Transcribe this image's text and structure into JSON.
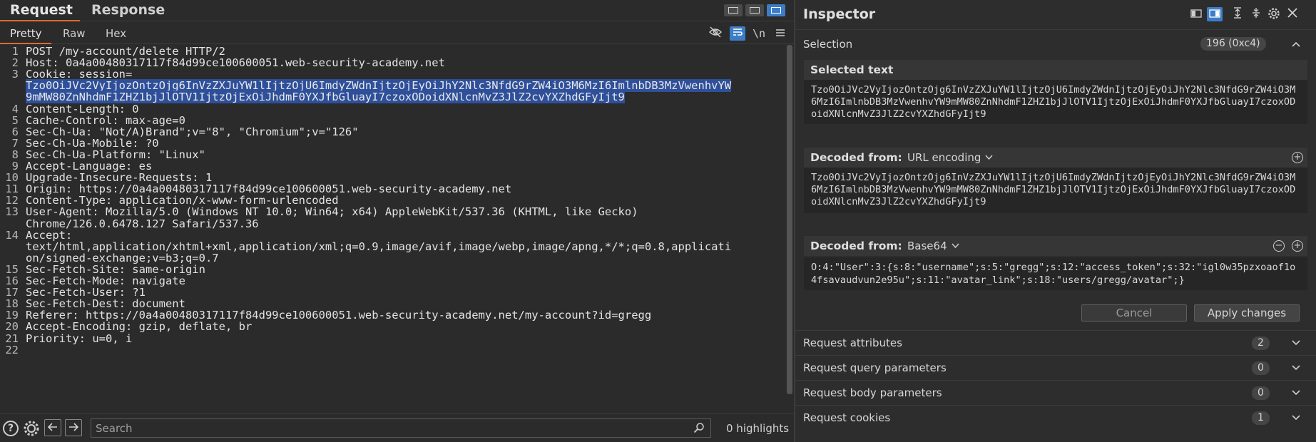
{
  "tabs": {
    "request": "Request",
    "response": "Response"
  },
  "view_tabs": {
    "pretty": "Pretty",
    "raw": "Raw",
    "hex": "Hex"
  },
  "toolbar": {
    "newline": "\\n"
  },
  "request_lines": [
    {
      "n": "1",
      "text": "POST /my-account/delete HTTP/2"
    },
    {
      "n": "2",
      "text": "Host: 0a4a00480317117f84d99ce100600051.web-security-academy.net"
    },
    {
      "n": "3",
      "text": "Cookie: session="
    },
    {
      "n": "",
      "text": "Tzo0OiJVc2VyIjozOntzOjg6InVzZXJuYW1lIjtzOjU6ImdyZWdnIjtzOjEyOiJhY2Nlc3NfdG9rZW4iO3M6MzI6ImlnbDB3MzVwenhvYW",
      "hl": true
    },
    {
      "n": "",
      "text": "9mMW80ZnNhdmF1ZHZ1bjJlOTV1IjtzOjExOiJhdmF0YXJfbGluayI7czoxODoidXNlcnMvZ3JlZ2cvYXZhdGFyIjt9",
      "hl": true
    },
    {
      "n": "4",
      "text": "Content-Length: 0"
    },
    {
      "n": "5",
      "text": "Cache-Control: max-age=0"
    },
    {
      "n": "6",
      "text": "Sec-Ch-Ua: \"Not/A)Brand\";v=\"8\", \"Chromium\";v=\"126\""
    },
    {
      "n": "7",
      "text": "Sec-Ch-Ua-Mobile: ?0"
    },
    {
      "n": "8",
      "text": "Sec-Ch-Ua-Platform: \"Linux\""
    },
    {
      "n": "9",
      "text": "Accept-Language: es"
    },
    {
      "n": "10",
      "text": "Upgrade-Insecure-Requests: 1"
    },
    {
      "n": "11",
      "text": "Origin: https://0a4a00480317117f84d99ce100600051.web-security-academy.net"
    },
    {
      "n": "12",
      "text": "Content-Type: application/x-www-form-urlencoded"
    },
    {
      "n": "13",
      "text": "User-Agent: Mozilla/5.0 (Windows NT 10.0; Win64; x64) AppleWebKit/537.36 (KHTML, like Gecko)"
    },
    {
      "n": "",
      "text": "Chrome/126.0.6478.127 Safari/537.36"
    },
    {
      "n": "14",
      "text": "Accept:"
    },
    {
      "n": "",
      "text": "text/html,application/xhtml+xml,application/xml;q=0.9,image/avif,image/webp,image/apng,*/*;q=0.8,applicati"
    },
    {
      "n": "",
      "text": "on/signed-exchange;v=b3;q=0.7"
    },
    {
      "n": "15",
      "text": "Sec-Fetch-Site: same-origin"
    },
    {
      "n": "16",
      "text": "Sec-Fetch-Mode: navigate"
    },
    {
      "n": "17",
      "text": "Sec-Fetch-User: ?1"
    },
    {
      "n": "18",
      "text": "Sec-Fetch-Dest: document"
    },
    {
      "n": "19",
      "text": "Referer: https://0a4a00480317117f84d99ce100600051.web-security-academy.net/my-account?id=gregg"
    },
    {
      "n": "20",
      "text": "Accept-Encoding: gzip, deflate, br"
    },
    {
      "n": "21",
      "text": "Priority: u=0, i"
    },
    {
      "n": "22",
      "text": ""
    }
  ],
  "search": {
    "placeholder": "Search",
    "highlights": "0 highlights"
  },
  "inspector": {
    "title": "Inspector",
    "selection": {
      "label": "Selection",
      "badge": "196 (0xc4)"
    },
    "selected_text": {
      "title": "Selected text",
      "value": "Tzo0OiJVc2VyIjozOntzOjg6InVzZXJuYW1lIjtzOjU6ImdyZWdnIjtzOjEyOiJhY2Nlc3NfdG9rZW4iO3M6MzI6ImlnbDB3MzVwenhvYW9mMW80ZnNhdmF1ZHZ1bjJlOTV1IjtzOjExOiJhdmF0YXJfbGluayI7czoxODoidXNlcnMvZ3JlZ2cvYXZhdGFyIjt9"
    },
    "decoded_url": {
      "title": "Decoded from:",
      "encoding": "URL encoding",
      "value": "Tzo0OiJVc2VyIjozOntzOjg6InVzZXJuYW1lIjtzOjU6ImdyZWdnIjtzOjEyOiJhY2Nlc3NfdG9rZW4iO3M6MzI6ImlnbDB3MzVwenhvYW9mMW80ZnNhdmF1ZHZ1bjJlOTV1IjtzOjExOiJhdmF0YXJfbGluayI7czoxODoidXNlcnMvZ3JlZ2cvYXZhdGFyIjt9"
    },
    "decoded_b64": {
      "title": "Decoded from:",
      "encoding": "Base64",
      "value": "O:4:\"User\":3:{s:8:\"username\";s:5:\"gregg\";s:12:\"access_token\";s:32:\"igl0w35pzxoaof1o4fsavaudvun2e95u\";s:11:\"avatar_link\";s:18:\"users/gregg/avatar\";}"
    },
    "buttons": {
      "cancel": "Cancel",
      "apply": "Apply changes"
    },
    "sections": [
      {
        "label": "Request attributes",
        "count": "2"
      },
      {
        "label": "Request query parameters",
        "count": "0"
      },
      {
        "label": "Request body parameters",
        "count": "0"
      },
      {
        "label": "Request cookies",
        "count": "1"
      }
    ]
  },
  "colors": {
    "accent": "#e06a2e",
    "selection": "#2e4f9a",
    "toggle": "#3d7dc7"
  }
}
